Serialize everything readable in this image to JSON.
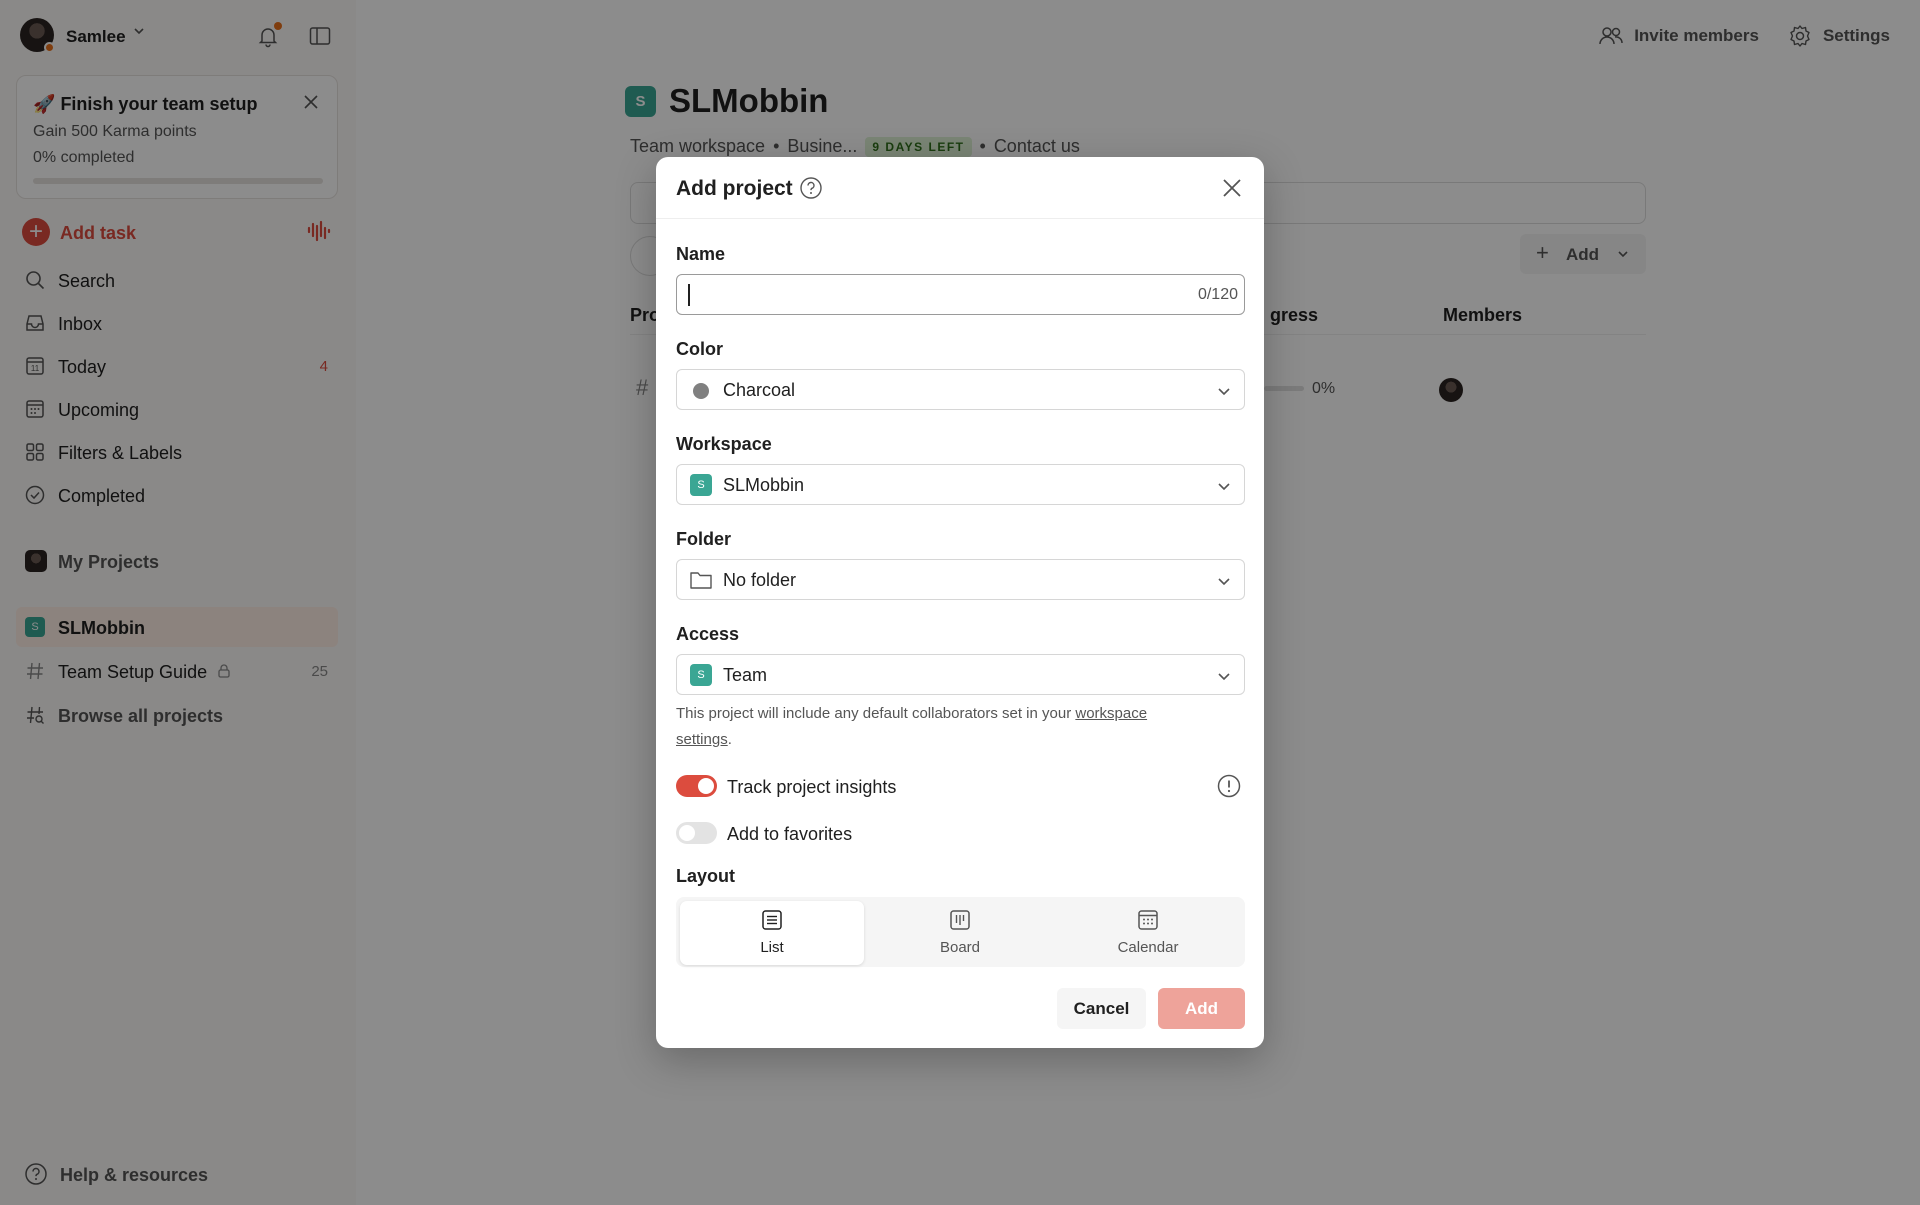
{
  "sidebar": {
    "user_name": "Samlee",
    "setup_card": {
      "emoji": "🚀",
      "title": "Finish your team setup",
      "subtitle": "Gain 500 Karma points",
      "progress_label": "0% completed",
      "progress": 0
    },
    "add_task": "Add task",
    "nav": {
      "search": "Search",
      "inbox": "Inbox",
      "today": "Today",
      "today_count": "4",
      "upcoming": "Upcoming",
      "filters": "Filters & Labels",
      "completed": "Completed"
    },
    "my_projects": "My Projects",
    "workspace_name": "SLMobbin",
    "workspace_badge": "S",
    "team_setup_guide": "Team Setup Guide",
    "team_setup_count": "25",
    "browse_all": "Browse all projects",
    "help": "Help & resources"
  },
  "topbar": {
    "invite": "Invite members",
    "settings": "Settings"
  },
  "main": {
    "badge": "S",
    "title": "SLMobbin",
    "meta_workspace": "Team workspace",
    "meta_plan": "Busine...",
    "days_left": "9 DAYS LEFT",
    "contact": "Contact us",
    "add_button": "Add",
    "col_projects": "Pro",
    "col_progress": "gress",
    "col_members": "Members",
    "row_progress": "0%"
  },
  "modal": {
    "title": "Add project",
    "name_label": "Name",
    "name_value": "",
    "name_counter": "0/120",
    "color_label": "Color",
    "color_value": "Charcoal",
    "color_hex": "#808080",
    "workspace_label": "Workspace",
    "workspace_value": "SLMobbin",
    "workspace_badge": "S",
    "folder_label": "Folder",
    "folder_value": "No folder",
    "access_label": "Access",
    "access_value": "Team",
    "access_badge": "S",
    "access_note_pre": "This project will include any default collaborators set in your ",
    "access_note_link": "workspace settings",
    "access_note_post": ".",
    "toggle_insights": "Track project insights",
    "toggle_insights_on": true,
    "toggle_favorites": "Add to favorites",
    "toggle_favorites_on": false,
    "layout_label": "Layout",
    "layout_options": [
      "List",
      "Board",
      "Calendar"
    ],
    "layout_selected": "List",
    "cancel": "Cancel",
    "add": "Add"
  },
  "colors": {
    "accent": "#dc4c3e",
    "workspace_teal": "#3aa694",
    "add_disabled": "#eea39a"
  }
}
